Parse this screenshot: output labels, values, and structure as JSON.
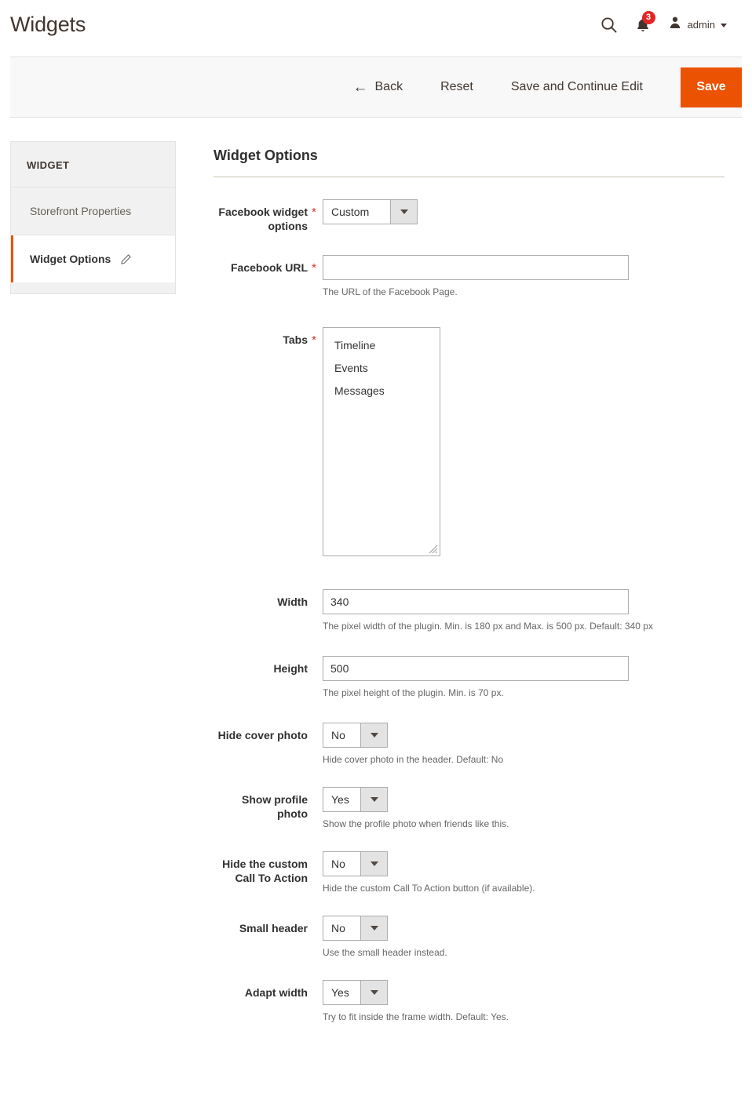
{
  "header": {
    "title": "Widgets",
    "search_icon": "search-icon",
    "notifications_icon": "bell-icon",
    "notifications_count": "3",
    "user_icon": "user-icon",
    "user_name": "admin",
    "caret_icon": "chevron-down-icon"
  },
  "toolbar": {
    "back_label": "Back",
    "back_icon": "arrow-left-icon",
    "reset_label": "Reset",
    "save_continue_label": "Save and Continue Edit",
    "save_label": "Save",
    "save_color": "#eb5202"
  },
  "sidebar": {
    "title": "WIDGET",
    "items": [
      {
        "label": "Storefront Properties",
        "active": false,
        "icon": ""
      },
      {
        "label": "Widget Options",
        "active": true,
        "icon": "pencil-icon"
      }
    ],
    "accent_color": "#eb5202"
  },
  "main": {
    "section_title": "Widget Options",
    "fields": [
      {
        "label": "Facebook widget options",
        "required": true,
        "type": "select",
        "value": "Custom",
        "note": ""
      },
      {
        "label": "Facebook URL",
        "required": true,
        "type": "text",
        "value": "",
        "placeholder": "",
        "note": "The URL of the Facebook Page."
      },
      {
        "label": "Tabs",
        "required": true,
        "type": "multiselect",
        "options": [
          "Timeline",
          "Events",
          "Messages"
        ],
        "note": ""
      },
      {
        "label": "Width",
        "required": false,
        "type": "text",
        "value": "340",
        "placeholder": "",
        "note": "The pixel width of the plugin. Min. is 180 px and Max. is 500 px. Default: 340 px"
      },
      {
        "label": "Height",
        "required": false,
        "type": "text",
        "value": "500",
        "placeholder": "",
        "note": "The pixel height of the plugin. Min. is 70 px."
      },
      {
        "label": "Hide cover photo",
        "required": false,
        "type": "select",
        "value": "No",
        "note": "Hide cover photo in the header. Default: No"
      },
      {
        "label": "Show profile photo",
        "required": false,
        "type": "select",
        "value": "Yes",
        "note": "Show the profile photo when friends like this."
      },
      {
        "label": "Hide the custom Call To Action",
        "required": false,
        "type": "select",
        "value": "No",
        "note": "Hide the custom Call To Action button (if available)."
      },
      {
        "label": "Small header",
        "required": false,
        "type": "select",
        "value": "No",
        "note": "Use the small header instead."
      },
      {
        "label": "Adapt width",
        "required": false,
        "type": "select",
        "value": "Yes",
        "note": "Try to fit inside the frame width. Default: Yes."
      }
    ]
  }
}
